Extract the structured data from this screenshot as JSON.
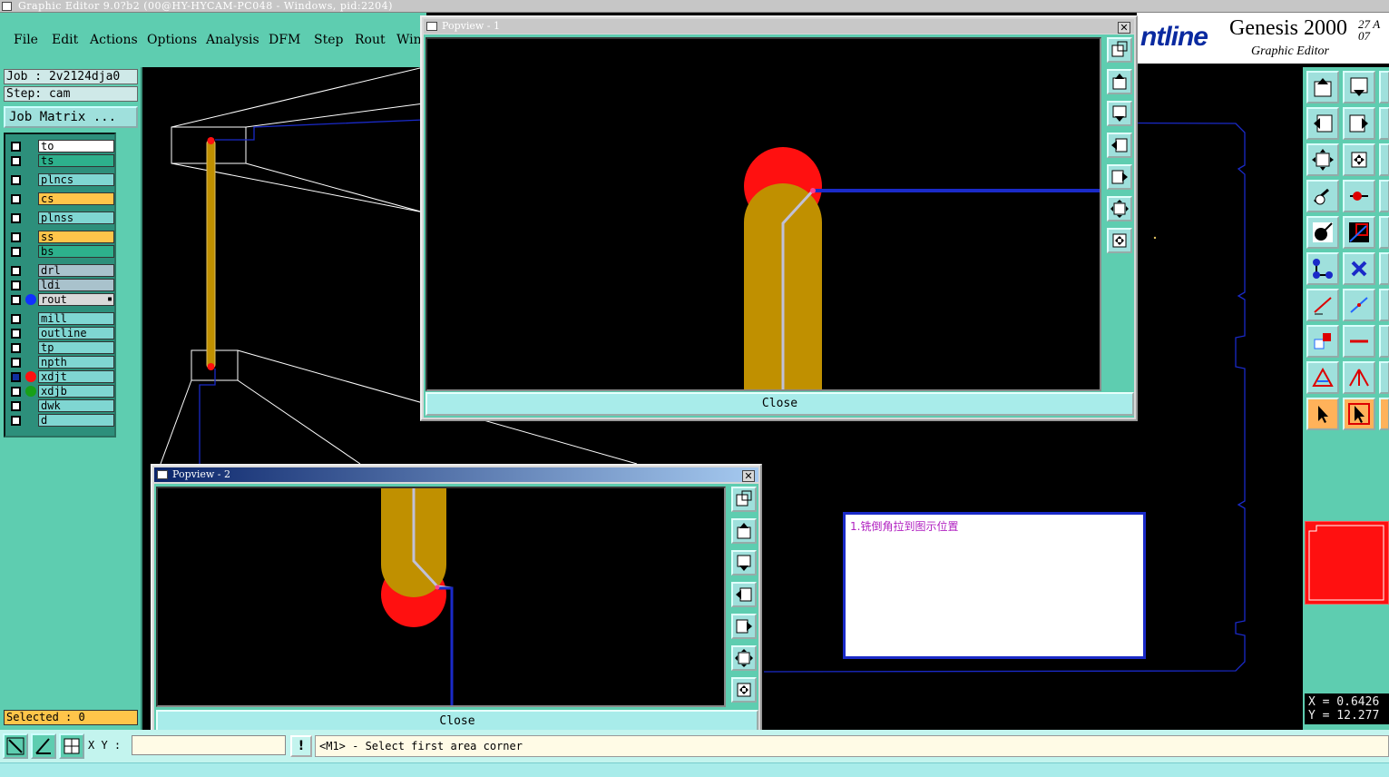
{
  "window": {
    "title": "Graphic Editor 9.0?b2 (00@HY-HYCAM-PC048 - Windows, pid:2204)"
  },
  "menu": {
    "items": [
      "File",
      "Edit",
      "Actions",
      "Options",
      "Analysis",
      "DFM",
      "Step",
      "Rout",
      "Win"
    ]
  },
  "logo": {
    "brand": "ntline",
    "product": "Genesis 2000",
    "version": "27 A\n07",
    "subtitle": "Graphic Editor"
  },
  "job": {
    "job_text": "Job : 2v2124dja0",
    "step_text": "Step: cam",
    "matrix_label": "Job Matrix ..."
  },
  "layers": [
    {
      "name": "to",
      "color": "#ffffff",
      "checked": false
    },
    {
      "name": "ts",
      "color": "#2db08c",
      "checked": false
    },
    {
      "name": "plncs",
      "color": "#7fd6d2",
      "checked": false
    },
    {
      "name": "cs",
      "color": "#ffc54a",
      "checked": false
    },
    {
      "name": "plnss",
      "color": "#7fd6d2",
      "checked": false
    },
    {
      "name": "ss",
      "color": "#ffc54a",
      "checked": false
    },
    {
      "name": "bs",
      "color": "#2db08c",
      "checked": false
    },
    {
      "name": "drl",
      "color": "#a9c2cc",
      "checked": false
    },
    {
      "name": "ldi",
      "color": "#a9c2cc",
      "checked": false
    },
    {
      "name": "rout",
      "color": "#d9d9d9",
      "checked": false,
      "dot": "#1030ff",
      "marker": "▪"
    },
    {
      "name": "mill",
      "color": "#7fd6d2",
      "checked": false
    },
    {
      "name": "outline",
      "color": "#7fd6d2",
      "checked": false
    },
    {
      "name": "tp",
      "color": "#7fd6d2",
      "checked": false
    },
    {
      "name": "npth",
      "color": "#7fd6d2",
      "checked": false
    },
    {
      "name": "xdjt",
      "color": "#7fd6d2",
      "checked": true,
      "dot": "#ff1010"
    },
    {
      "name": "xdjb",
      "color": "#7fd6d2",
      "checked": false,
      "dot": "#18a018"
    },
    {
      "name": "dwk",
      "color": "#7fd6d2",
      "checked": false
    },
    {
      "name": "d",
      "color": "#7fd6d2",
      "checked": false
    }
  ],
  "selected_text": "Selected : 0",
  "coords": {
    "x_text": "X = 0.6426",
    "y_text": "Y = 12.277"
  },
  "bottom": {
    "xy_label": "X Y :",
    "xy_value": "",
    "warn_glyph": "!",
    "status": "<M1> - Select first area corner"
  },
  "note": {
    "text": "1.铣倒角拉到图示位置"
  },
  "popview1": {
    "title": "Popview - 1",
    "close_label": "Close",
    "close_glyph": "✕"
  },
  "popview2": {
    "title": "Popview - 2",
    "close_label": "Close",
    "close_glyph": "✕"
  },
  "colors": {
    "accent": "#5ecdb0",
    "copper": "#c09000",
    "pad": "#ff1010",
    "rout": "#1a2ac8"
  }
}
